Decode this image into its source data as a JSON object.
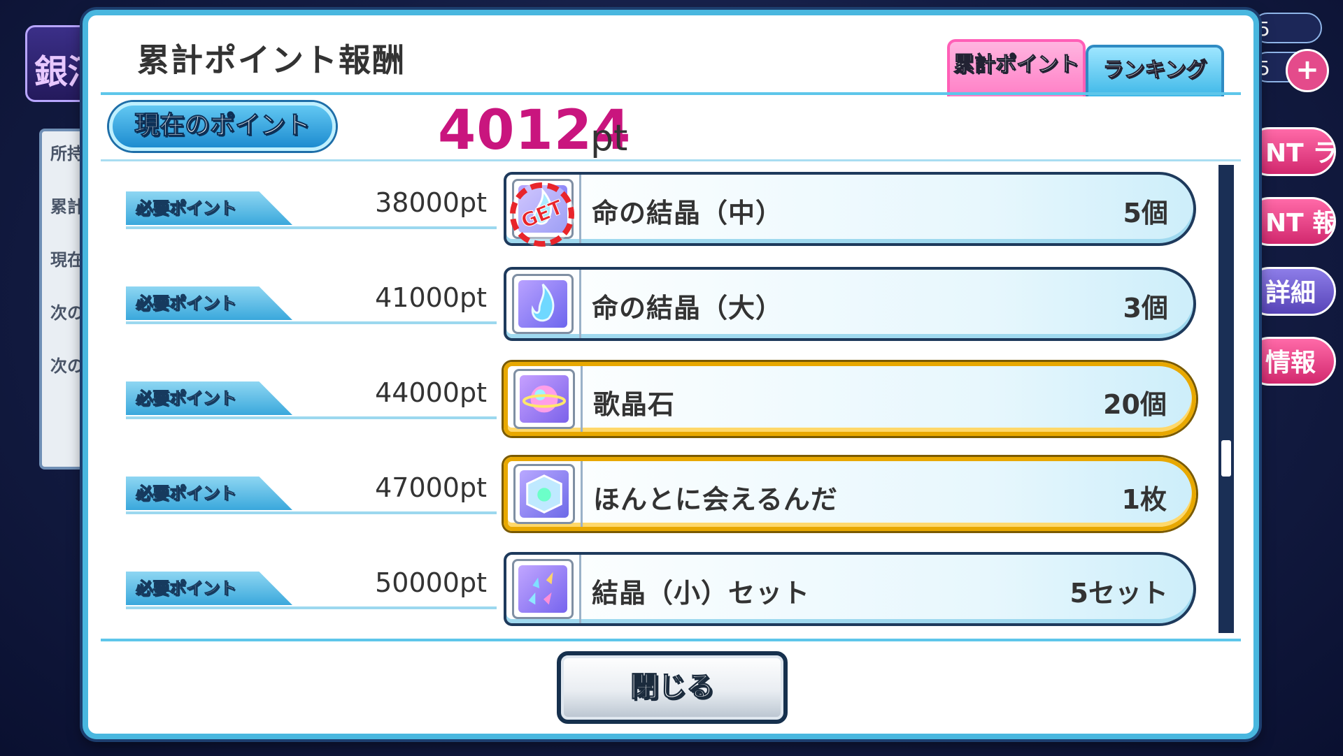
{
  "background": {
    "corner_title": "銀河",
    "left_labels": [
      "所持",
      "累計",
      "現在",
      "次の",
      "次の"
    ],
    "right_buttons": [
      "NT ランキング",
      "NT 報酬",
      "詳細",
      "情報"
    ],
    "counters": [
      "5",
      "5"
    ],
    "plus_label": "+"
  },
  "modal": {
    "title": "累計ポイント報酬",
    "tabs": [
      {
        "label": "累計ポイント",
        "active": true
      },
      {
        "label": "ランキング",
        "active": false
      }
    ],
    "current_label": "現在のポイント",
    "current_points": "40124",
    "current_unit": "pt",
    "close_label": "閉じる"
  },
  "rewards": [
    {
      "req_label": "必要ポイント",
      "req_points": "38000pt",
      "name": "命の結晶（中）",
      "qty": "5個",
      "icon": "blue-crystal-icon",
      "obtained": true,
      "stamp": "GET",
      "highlight": false
    },
    {
      "req_label": "必要ポイント",
      "req_points": "41000pt",
      "name": "命の結晶（大）",
      "qty": "3個",
      "icon": "blue-flame-crystal-icon",
      "obtained": false,
      "highlight": false
    },
    {
      "req_label": "必要ポイント",
      "req_points": "44000pt",
      "name": "歌晶石",
      "qty": "20個",
      "icon": "rainbow-planet-gem-icon",
      "obtained": false,
      "highlight": true
    },
    {
      "req_label": "必要ポイント",
      "req_points": "47000pt",
      "name": "ほんとに会えるんだ",
      "qty": "1枚",
      "icon": "card-cube-icon",
      "obtained": false,
      "highlight": true
    },
    {
      "req_label": "必要ポイント",
      "req_points": "50000pt",
      "name": "結晶（小）セット",
      "qty": "5セット",
      "icon": "crystal-set-icon",
      "obtained": false,
      "highlight": false
    }
  ],
  "colors": {
    "accent_blue": "#49b7df",
    "points_magenta": "#c9157e",
    "highlight_gold": "#e8a800",
    "tab_active_pink": "#ff7fc6"
  }
}
